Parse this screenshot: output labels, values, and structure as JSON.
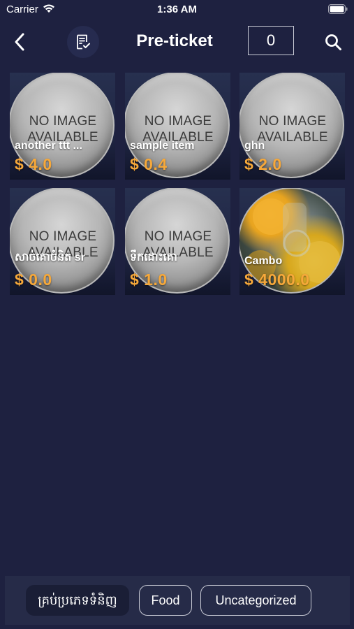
{
  "status_bar": {
    "carrier": "Carrier",
    "time": "1:36 AM"
  },
  "nav": {
    "title": "Pre-ticket",
    "count": "0"
  },
  "placeholder": {
    "line1": "NO IMAGE",
    "line2": "AVAILABLE"
  },
  "items": [
    {
      "name": "another ttt ...",
      "price": "$ 4.0",
      "has_image": false
    },
    {
      "name": "sample item",
      "price": "$ 0.4",
      "has_image": false
    },
    {
      "name": "ghn",
      "price": "$ 2.0",
      "has_image": false
    },
    {
      "name": "សាច់គោចំនិត sr",
      "price": "$ 0.0",
      "has_image": false
    },
    {
      "name": "ទឹកដោះគោ",
      "price": "$ 1.0",
      "has_image": false
    },
    {
      "name": "Cambo",
      "price": "$ 4000.0",
      "has_image": true
    }
  ],
  "categories": [
    {
      "label": "គ្រប់ប្រភេទទំនិញ",
      "selected": true
    },
    {
      "label": "Food",
      "selected": false
    },
    {
      "label": "Uncategorized",
      "selected": false
    }
  ],
  "colors": {
    "background": "#1e2140",
    "price": "#f6a83a",
    "text": "#ffffff"
  }
}
